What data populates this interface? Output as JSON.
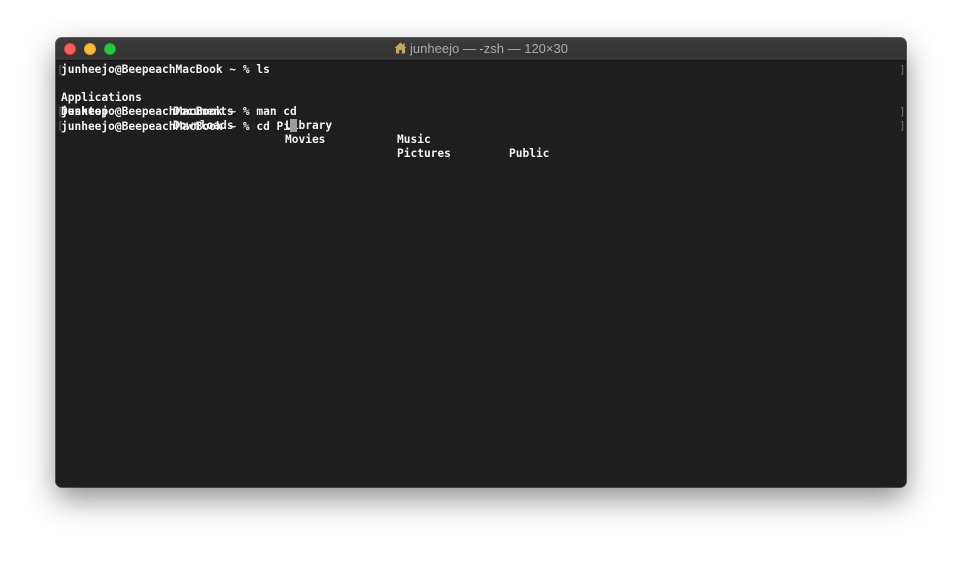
{
  "window": {
    "title": "junheejo — -zsh — 120×30",
    "title_icon": "home-icon",
    "controls": [
      "close",
      "minimize",
      "zoom"
    ],
    "colors": {
      "background": "#1e1e1e",
      "text": "#f2f2f2",
      "close": "#ff5f57",
      "minimize": "#febc2e",
      "zoom": "#28c840"
    }
  },
  "terminal": {
    "prompt": "junheejo@BeepeachMacBook ~ %",
    "commands": [
      "ls",
      "man cd",
      "cd Pi"
    ],
    "ls_output": {
      "row1": [
        "Applications",
        "Documents",
        "Library",
        "Music",
        "Public"
      ],
      "row2": [
        "Desktop",
        "Downloads",
        "Movies",
        "Pictures"
      ]
    },
    "line_marks": {
      "left": "[",
      "right": "]"
    }
  }
}
